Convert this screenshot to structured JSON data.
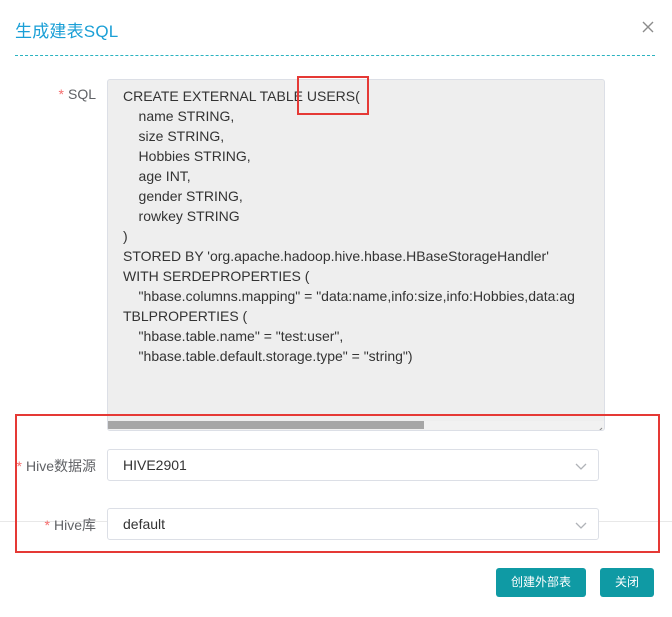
{
  "dialog": {
    "title": "生成建表SQL",
    "close_icon": "close-icon"
  },
  "form": {
    "sql": {
      "required_mark": "*",
      "label": "SQL",
      "value": "CREATE EXTERNAL TABLE USERS(\n    name STRING,\n    size STRING,\n    Hobbies STRING,\n    age INT,\n    gender STRING,\n    rowkey STRING\n)\nSTORED BY 'org.apache.hadoop.hive.hbase.HBaseStorageHandler'\nWITH SERDEPROPERTIES (\n    \"hbase.columns.mapping\" = \"data:name,info:size,info:Hobbies,data:ag\nTBLPROPERTIES (\n    \"hbase.table.name\" = \"test:user\",\n    \"hbase.table.default.storage.type\" = \"string\")"
    },
    "hive_source": {
      "required_mark": "*",
      "label": "Hive数据源",
      "value": "HIVE2901"
    },
    "hive_db": {
      "required_mark": "*",
      "label": "Hive库",
      "value": "default"
    }
  },
  "buttons": {
    "create_external_table": "创建外部表",
    "close": "关闭"
  },
  "colors": {
    "title": "#1a9fd6",
    "accent": "#0f9aa4",
    "highlight": "#e53935",
    "required": "#f56c6c"
  }
}
